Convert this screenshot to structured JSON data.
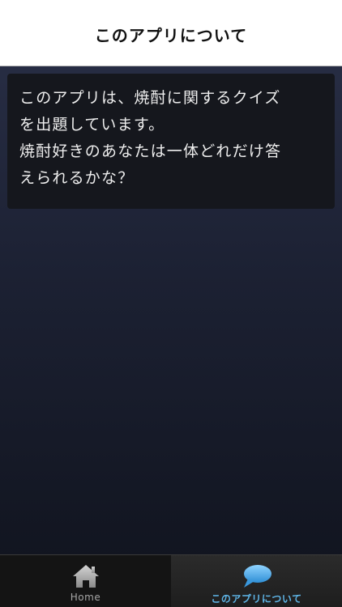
{
  "navbar": {
    "title": "このアプリについて"
  },
  "about": {
    "text": "このアプリは、焼酎に関するクイズ\nを出題しています。\n焼酎好きのあなたは一体どれだけ答\nえられるかな？"
  },
  "tabbar": {
    "tabs": [
      {
        "label": "Home",
        "icon": "home-icon",
        "selected": false
      },
      {
        "label": "このアプリについて",
        "icon": "speech-bubble-icon",
        "selected": true
      }
    ]
  },
  "colors": {
    "navbar_bg": "#ffffff",
    "background_top": "#2a3048",
    "background_bottom": "#10131d",
    "card_bg": "#15171d",
    "tab_active": "#5fb6e8",
    "tab_inactive": "#a6a6a6"
  }
}
